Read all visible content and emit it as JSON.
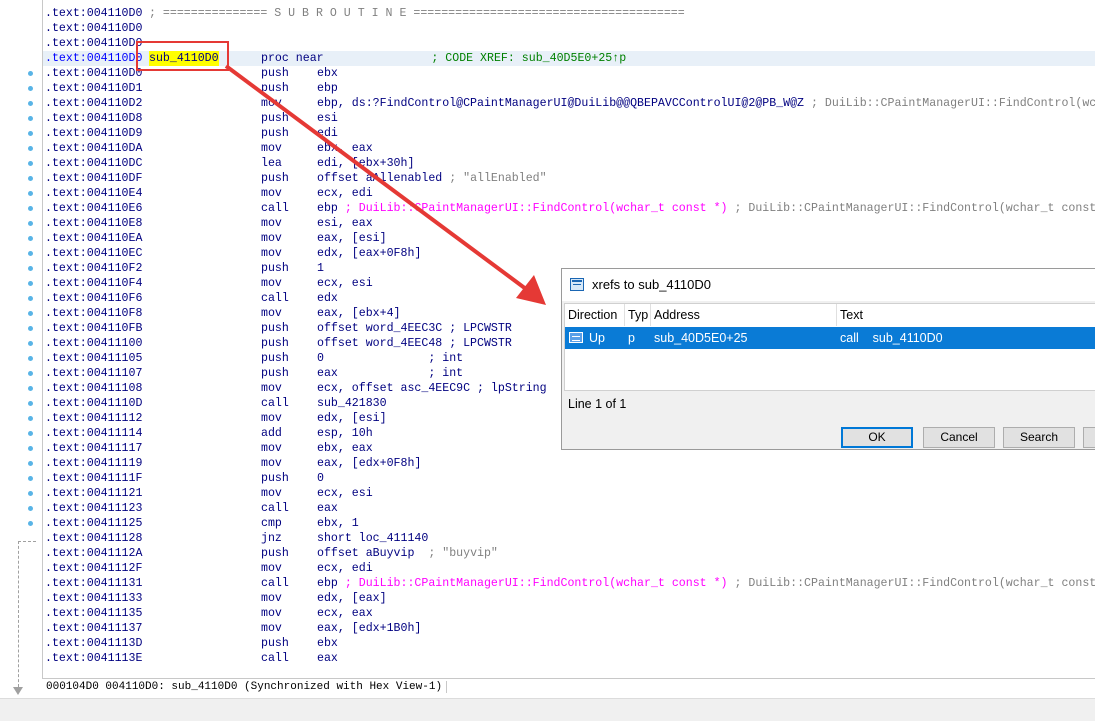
{
  "listing": {
    "rows": [
      {
        "addr": ".text:004110D0",
        "sep": "; =============== S U B R O U T I N E ======================================="
      },
      {
        "addr": ".text:004110D0"
      },
      {
        "addr": ".text:004110D0"
      },
      {
        "addr": ".text:004110D0",
        "label": "sub_4110D0",
        "mnem": "proc near",
        "ops": "               ; CODE XREF: sub_40D5E0+25↑p",
        "hl": true
      },
      {
        "addr": ".text:004110D0",
        "mnem": "push",
        "ops": "ebx"
      },
      {
        "addr": ".text:004110D1",
        "mnem": "push",
        "ops": "ebp"
      },
      {
        "addr": ".text:004110D2",
        "mnem": "mov",
        "ops": "ebp, ds:?FindControl@CPaintManagerUI@DuiLib@@QBEPAVCControlUI@2@PB_W@Z",
        "tail": " ; DuiLib::CPaintManagerUI::FindControl(wchar_t const *)"
      },
      {
        "addr": ".text:004110D8",
        "mnem": "push",
        "ops": "esi"
      },
      {
        "addr": ".text:004110D9",
        "mnem": "push",
        "ops": "edi"
      },
      {
        "addr": ".text:004110DA",
        "mnem": "mov",
        "ops": "ebx, eax"
      },
      {
        "addr": ".text:004110DC",
        "mnem": "lea",
        "ops": "edi, [ebx+30h]"
      },
      {
        "addr": ".text:004110DF",
        "mnem": "push",
        "ops": "offset aAllenabled",
        "tail": " ; \"allEnabled\""
      },
      {
        "addr": ".text:004110E4",
        "mnem": "mov",
        "ops": "ecx, edi"
      },
      {
        "addr": ".text:004110E6",
        "mnem": "call",
        "ops": "ebp",
        "fn": " ; DuiLib::CPaintManagerUI::FindControl(wchar_t const *)",
        "tail": " ; DuiLib::CPaintManagerUI::FindControl(wchar_t const *)"
      },
      {
        "addr": ".text:004110E8",
        "mnem": "mov",
        "ops": "esi, eax"
      },
      {
        "addr": ".text:004110EA",
        "mnem": "mov",
        "ops": "eax, [esi]"
      },
      {
        "addr": ".text:004110EC",
        "mnem": "mov",
        "ops": "edx, [eax+0F8h]"
      },
      {
        "addr": ".text:004110F2",
        "mnem": "push",
        "ops": "1"
      },
      {
        "addr": ".text:004110F4",
        "mnem": "mov",
        "ops": "ecx, esi"
      },
      {
        "addr": ".text:004110F6",
        "mnem": "call",
        "ops": "edx"
      },
      {
        "addr": ".text:004110F8",
        "mnem": "mov",
        "ops": "eax, [ebx+4]"
      },
      {
        "addr": ".text:004110FB",
        "mnem": "push",
        "ops": "offset word_4EEC3C ; LPCWSTR"
      },
      {
        "addr": ".text:00411100",
        "mnem": "push",
        "ops": "offset word_4EEC48 ; LPCWSTR"
      },
      {
        "addr": ".text:00411105",
        "mnem": "push",
        "ops": "0               ; int"
      },
      {
        "addr": ".text:00411107",
        "mnem": "push",
        "ops": "eax             ; int"
      },
      {
        "addr": ".text:00411108",
        "mnem": "mov",
        "ops": "ecx, offset asc_4EEC9C ; lpString"
      },
      {
        "addr": ".text:0041110D",
        "mnem": "call",
        "ops": "sub_421830"
      },
      {
        "addr": ".text:00411112",
        "mnem": "mov",
        "ops": "edx, [esi]"
      },
      {
        "addr": ".text:00411114",
        "mnem": "add",
        "ops": "esp, 10h"
      },
      {
        "addr": ".text:00411117",
        "mnem": "mov",
        "ops": "ebx, eax"
      },
      {
        "addr": ".text:00411119",
        "mnem": "mov",
        "ops": "eax, [edx+0F8h]"
      },
      {
        "addr": ".text:0041111F",
        "mnem": "push",
        "ops": "0"
      },
      {
        "addr": ".text:00411121",
        "mnem": "mov",
        "ops": "ecx, esi"
      },
      {
        "addr": ".text:00411123",
        "mnem": "call",
        "ops": "eax"
      },
      {
        "addr": ".text:00411125",
        "mnem": "cmp",
        "ops": "ebx, 1"
      },
      {
        "addr": ".text:00411128",
        "mnem": "jnz",
        "ops": "short loc_411140"
      },
      {
        "addr": ".text:0041112A",
        "mnem": "push",
        "ops": "offset aBuyvip",
        "tail": "  ; \"buyvip\""
      },
      {
        "addr": ".text:0041112F",
        "mnem": "mov",
        "ops": "ecx, edi"
      },
      {
        "addr": ".text:00411131",
        "mnem": "call",
        "ops": "ebp",
        "fn": " ; DuiLib::CPaintManagerUI::FindControl(wchar_t const *)",
        "tail": " ; DuiLib::CPaintManagerUI::FindControl(wchar_t const *)"
      },
      {
        "addr": ".text:00411133",
        "mnem": "mov",
        "ops": "edx, [eax]"
      },
      {
        "addr": ".text:00411135",
        "mnem": "mov",
        "ops": "ecx, eax"
      },
      {
        "addr": ".text:00411137",
        "mnem": "mov",
        "ops": "eax, [edx+1B0h]"
      },
      {
        "addr": ".text:0041113D",
        "mnem": "push",
        "ops": "ebx"
      },
      {
        "addr": ".text:0041113E",
        "mnem": "call",
        "ops": "eax"
      }
    ]
  },
  "status": {
    "text": "000104D0 004110D0: sub_4110D0 (Synchronized with Hex View-1)"
  },
  "dialog": {
    "title": "xrefs to sub_4110D0",
    "columns": [
      "Direction",
      "Typ",
      "Address",
      "Text"
    ],
    "row": {
      "direction": "Up",
      "type": "p",
      "address": "sub_40D5E0+25",
      "text": "call    sub_4110D0"
    },
    "info": "Line 1 of 1",
    "buttons": {
      "ok": "OK",
      "cancel": "Cancel",
      "search": "Search"
    }
  },
  "colors": {
    "annotation_red": "#e53935",
    "selection_blue": "#0a7bd6",
    "label_highlight": "#ffff00"
  }
}
